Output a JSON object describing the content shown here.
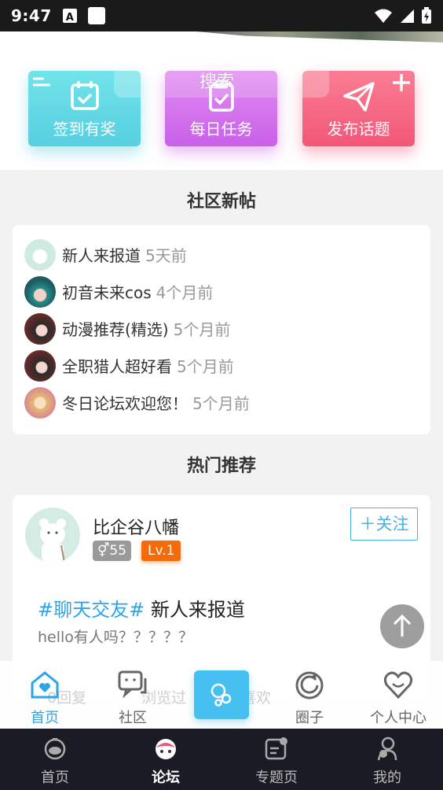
{
  "status_bar": {
    "time": "9:47",
    "notif_icon_letter": "A"
  },
  "search_hint": "搜索",
  "quick_actions": [
    {
      "label": "签到有奖",
      "icon": "calendar-check-icon",
      "color": "#56cfe0"
    },
    {
      "label": "每日任务",
      "icon": "calendar-check-icon",
      "color": "#c960ea"
    },
    {
      "label": "发布话题",
      "icon": "paper-plane-icon",
      "color": "#f15877"
    }
  ],
  "new_posts": {
    "title": "社区新帖",
    "items": [
      {
        "title": "新人来报道",
        "time": "5天前"
      },
      {
        "title": "初音未来cos",
        "time": "4个月前"
      },
      {
        "title": "动漫推荐(精选)",
        "time": "5个月前"
      },
      {
        "title": "全职猎人超好看",
        "time": "5个月前"
      },
      {
        "title": "冬日论坛欢迎您！",
        "time": "5个月前"
      }
    ]
  },
  "hot": {
    "title": "热门推荐",
    "post": {
      "user_name": "比企谷八幡",
      "gender_badge": "55",
      "level": "Lv.1",
      "follow_label": "关注",
      "topic_tag": "#聊天交友#",
      "topic_title": "新人来报道",
      "excerpt": "hello有人吗？？？？？",
      "reply_count": "0回复",
      "view_label": "浏览过",
      "like_label": "喜欢"
    }
  },
  "inner_tabs": [
    {
      "label": "首页",
      "active": true
    },
    {
      "label": "社区",
      "active": false
    },
    {
      "label": "",
      "active": false
    },
    {
      "label": "圈子",
      "active": false
    },
    {
      "label": "个人中心",
      "active": false
    }
  ],
  "bottom_nav": [
    {
      "label": "首页",
      "active": false
    },
    {
      "label": "论坛",
      "active": true
    },
    {
      "label": "专题页",
      "active": false
    },
    {
      "label": "我的",
      "active": false
    }
  ],
  "colors": {
    "accent_blue": "#2aa6e8",
    "level_orange": "#f56b0a",
    "nav_bg": "#1b1b26"
  }
}
